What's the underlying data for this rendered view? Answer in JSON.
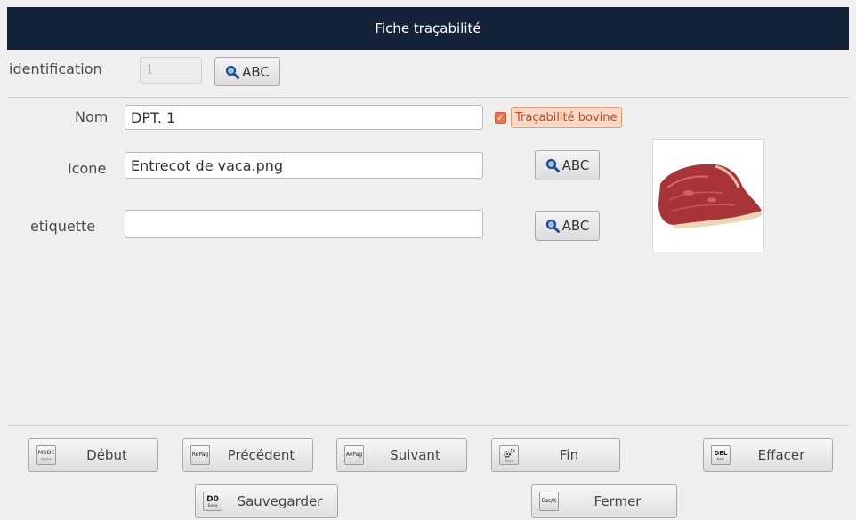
{
  "window": {
    "title": "Fiche traçabilité"
  },
  "identification": {
    "label": "identification",
    "value": "1",
    "search_label": "ABC",
    "search_icon": "magnifier-icon"
  },
  "form": {
    "nom": {
      "label": "Nom",
      "value": "DPT. 1"
    },
    "tracabilite": {
      "label": "Traçabilité bovine",
      "checked": true
    },
    "icone": {
      "label": "Icone",
      "value": "Entrecot de vaca.png",
      "search_label": "ABC"
    },
    "etiquette": {
      "label": "etiquette",
      "value": "",
      "search_label": "ABC"
    }
  },
  "colors": {
    "titlebar": "#14233a",
    "accent": "#e9734a"
  },
  "toolbar": {
    "debut": {
      "label": "Début",
      "key": "MODE",
      "key_sub": "Home"
    },
    "precedent": {
      "label": "Précédent",
      "key": "RePag"
    },
    "suivant": {
      "label": "Suivant",
      "key": "AvPag"
    },
    "fin": {
      "label": "Fin",
      "key_icon": "gears-icon",
      "key_sub": "End"
    },
    "effacer": {
      "label": "Effacer",
      "key": "DEL",
      "key_sub": "Ins."
    },
    "sauvegarder": {
      "label": "Sauvegarder",
      "key": "D0",
      "key_sub": "Save"
    },
    "fermer": {
      "label": "Fermer",
      "key": "Esc/K"
    }
  }
}
